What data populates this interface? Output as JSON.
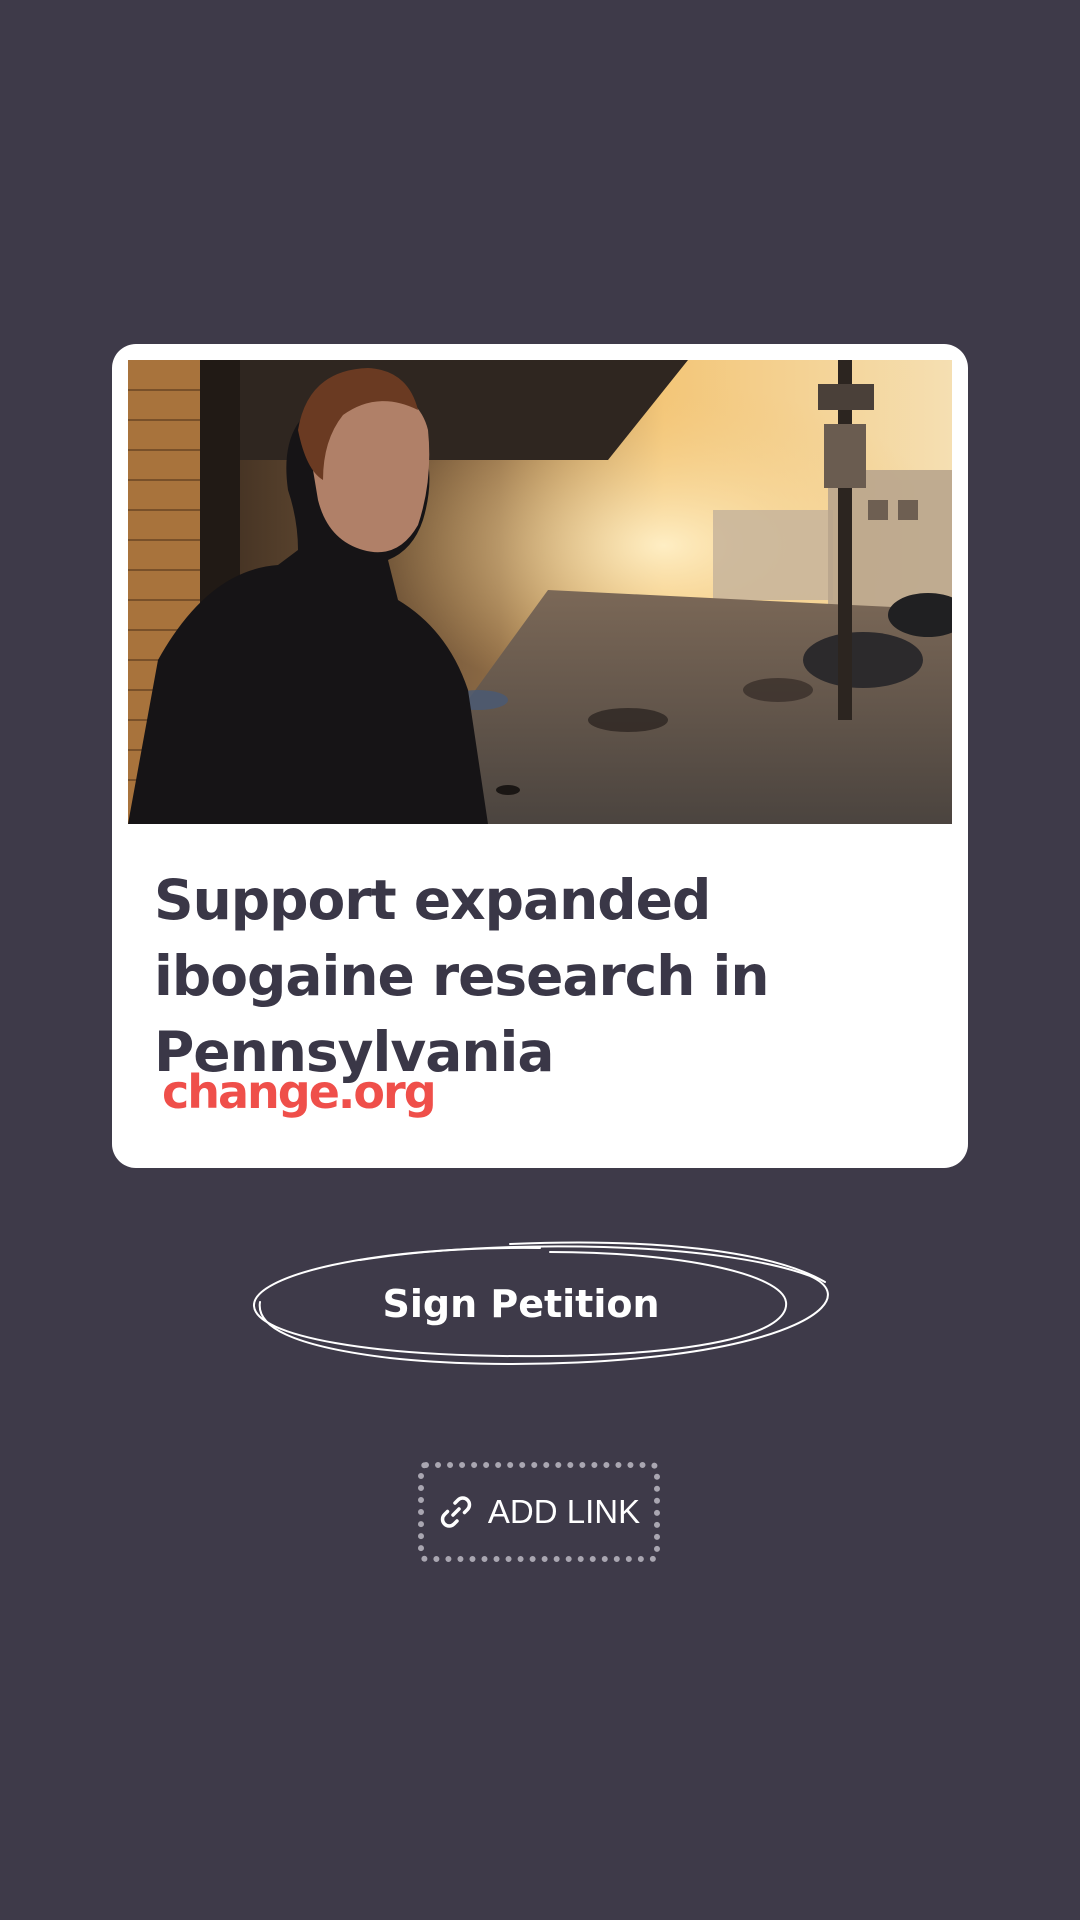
{
  "card": {
    "title": "Support expanded ibogaine research in Pennsylvania",
    "brand": "change.org"
  },
  "actions": {
    "sign_label": "Sign Petition",
    "add_link_label": "ADD LINK"
  },
  "colors": {
    "background": "#3e3a49",
    "title_text": "#3a3747",
    "brand": "#ef4f4a",
    "dotted_border": "#a9a6b1"
  },
  "icons": {
    "add_link": "link-icon"
  }
}
